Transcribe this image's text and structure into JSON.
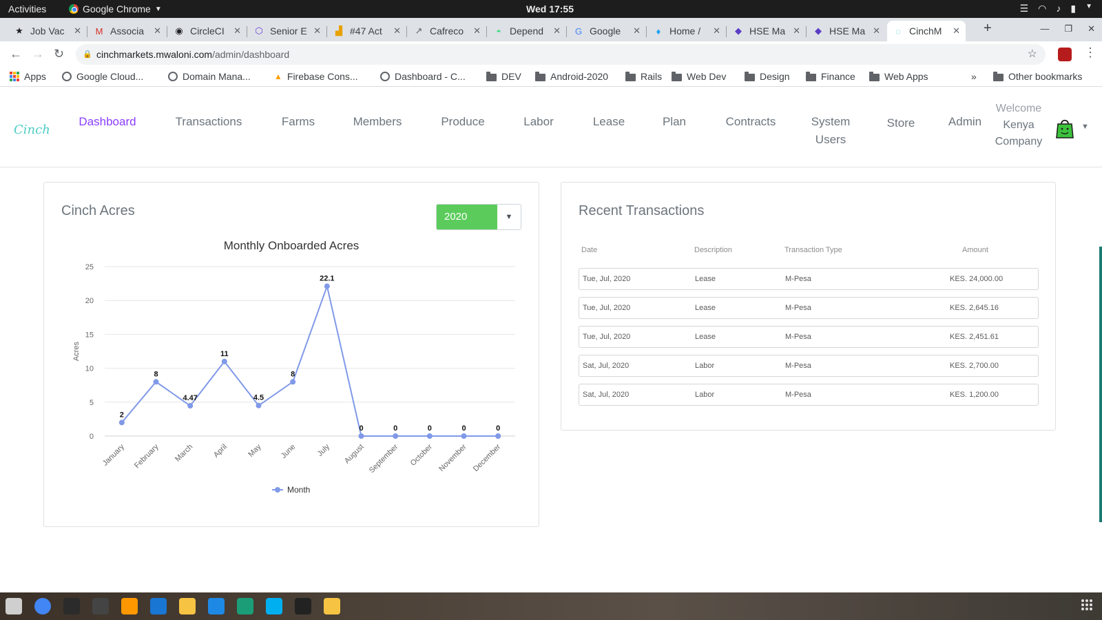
{
  "system_bar": {
    "activities": "Activities",
    "app_name": "Google Chrome",
    "clock": "Wed 17:55"
  },
  "browser": {
    "tabs": [
      {
        "title": "Job Vac",
        "icon": "person-icon"
      },
      {
        "title": "Associa",
        "icon": "gmail-icon"
      },
      {
        "title": "CircleCI",
        "icon": "circleci-icon"
      },
      {
        "title": "Senior E",
        "icon": "hexagon-icon"
      },
      {
        "title": "#47 Act",
        "icon": "chart-icon"
      },
      {
        "title": "Cafreco",
        "icon": "arrow-icon"
      },
      {
        "title": "Depend",
        "icon": "android-icon"
      },
      {
        "title": "Google",
        "icon": "google-icon"
      },
      {
        "title": "Home /",
        "icon": "twitter-icon"
      },
      {
        "title": "HSE Ma",
        "icon": "cube-icon"
      },
      {
        "title": "HSE Ma",
        "icon": "cube-icon"
      },
      {
        "title": "CinchM",
        "icon": "cinch-icon",
        "active": true
      }
    ],
    "url": {
      "host": "cinchmarkets.mwaloni.com",
      "path": "/admin/dashboard"
    },
    "bookmarks": [
      "Apps",
      "Google Cloud...",
      "Domain Mana...",
      "Firebase Cons...",
      "Dashboard - C...",
      "DEV",
      "Android-2020",
      "Rails",
      "Web Dev",
      "Design",
      "Finance",
      "Web Apps"
    ],
    "bookmarks_overflow": "»",
    "other_bookmarks": "Other bookmarks"
  },
  "app": {
    "brand": "Cinch",
    "nav": [
      {
        "label": "Dashboard",
        "active": true
      },
      {
        "label": "Transactions"
      },
      {
        "label": "Farms"
      },
      {
        "label": "Members"
      },
      {
        "label": "Produce"
      },
      {
        "label": "Labor"
      },
      {
        "label": "Lease"
      },
      {
        "label": "Plan"
      },
      {
        "label": "Contracts"
      },
      {
        "label": "System Users"
      },
      {
        "label": "Store"
      },
      {
        "label": "Admin"
      }
    ],
    "welcome_line1": "Welcome",
    "welcome_name": "Kenya Company"
  },
  "acres_card": {
    "title": "Cinch Acres",
    "year_selected": "2020"
  },
  "chart_data": {
    "type": "line",
    "title": "Monthly Onboarded Acres",
    "xlabel": "",
    "ylabel": "Acres",
    "categories": [
      "January",
      "February",
      "March",
      "April",
      "May",
      "June",
      "July",
      "August",
      "September",
      "October",
      "November",
      "December"
    ],
    "series": [
      {
        "name": "Month",
        "values": [
          2,
          8,
          4.47,
          11,
          4.5,
          8,
          22.1,
          0,
          0,
          0,
          0,
          0
        ],
        "color": "#8099e8"
      }
    ],
    "data_labels": [
      "2",
      "8",
      "4.47",
      "11",
      "4.5",
      "8",
      "22.1",
      "0",
      "0",
      "0",
      "0",
      "0"
    ],
    "ylim": [
      0,
      25
    ],
    "yticks": [
      0,
      5,
      10,
      15,
      20,
      25
    ],
    "grid": true,
    "legend": "bottom"
  },
  "transactions_card": {
    "title": "Recent Transactions",
    "columns": [
      "Date",
      "Description",
      "Transaction Type",
      "Amount"
    ],
    "rows": [
      {
        "date": "Tue, Jul, 2020",
        "description": "Lease",
        "type": "M-Pesa",
        "amount": "KES. 24,000.00"
      },
      {
        "date": "Tue, Jul, 2020",
        "description": "Lease",
        "type": "M-Pesa",
        "amount": "KES. 2,645.16"
      },
      {
        "date": "Tue, Jul, 2020",
        "description": "Lease",
        "type": "M-Pesa",
        "amount": "KES. 2,451.61"
      },
      {
        "date": "Sat, Jul, 2020",
        "description": "Labor",
        "type": "M-Pesa",
        "amount": "KES. 2,700.00"
      },
      {
        "date": "Sat, Jul, 2020",
        "description": "Labor",
        "type": "M-Pesa",
        "amount": "KES. 1,200.00"
      }
    ]
  },
  "colors": {
    "accent": "#8b3dff",
    "select_green": "#5bcc5b",
    "line": "#8099e8",
    "brand": "#4ecdc4"
  }
}
